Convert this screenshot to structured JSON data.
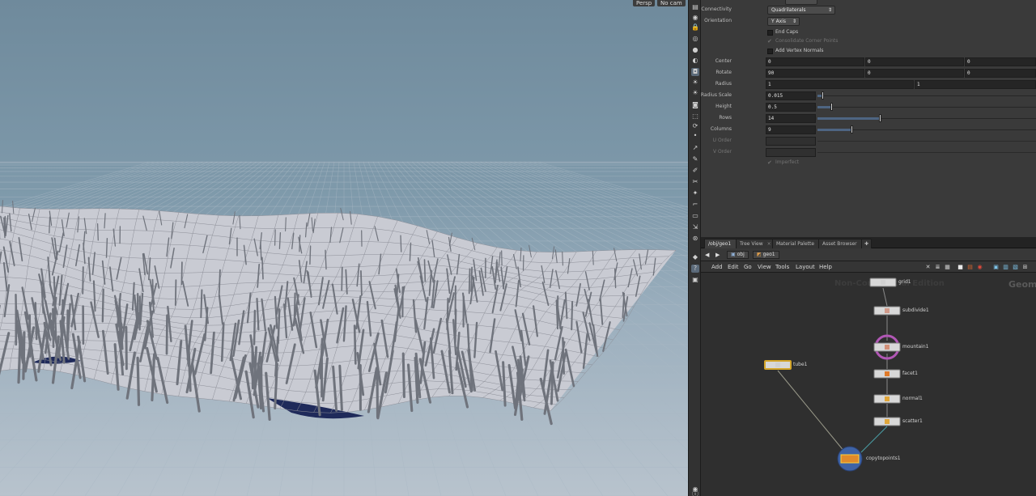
{
  "viewport": {
    "menu_persp": "Persp",
    "menu_camera": "No cam"
  },
  "toolstrip": {
    "icons": [
      "display-options-icon",
      "snap-icon",
      "lock-icon",
      "visibility-icon",
      "shading-icon",
      "ghost-icon",
      "select-mode-icon",
      "light-icon",
      "light2-icon",
      "handle-icon",
      "transform-icon",
      "cook-icon",
      "dot-icon",
      "wire-icon",
      "pen-icon",
      "edit-icon",
      "brush-icon",
      "paint-icon",
      "edge-icon",
      "poly-icon",
      "scale-icon",
      "pin-icon",
      "keyframe-icon",
      "help-icon",
      "render-icon",
      "camera-icon",
      "info-icon"
    ]
  },
  "params": {
    "connectivity": {
      "label": "Connectivity",
      "value": "Quadrilaterals"
    },
    "orientation": {
      "label": "Orientation",
      "value": "Y Axis"
    },
    "end_caps": {
      "label": "End Caps"
    },
    "consolidate": {
      "label": "Consolidate Corner Points"
    },
    "vertex_normals": {
      "label": "Add Vertex Normals"
    },
    "center": {
      "label": "Center",
      "x": "0",
      "y": "0",
      "z": "0"
    },
    "rotate": {
      "label": "Rotate",
      "x": "90",
      "y": "0",
      "z": "0"
    },
    "radius": {
      "label": "Radius",
      "x": "1",
      "y": "1"
    },
    "radius_scale": {
      "label": "Radius Scale",
      "value": "0.015",
      "level": 0.02
    },
    "height": {
      "label": "Height",
      "value": "0.5",
      "level": 0.06
    },
    "rows": {
      "label": "Rows",
      "value": "14",
      "level": 0.28
    },
    "columns": {
      "label": "Columns",
      "value": "9",
      "level": 0.15
    },
    "u_order": {
      "label": "U Order"
    },
    "v_order": {
      "label": "V Order"
    },
    "imperfect": {
      "label": "Imperfect"
    }
  },
  "network": {
    "tabs": [
      {
        "label": "/obj/geo1",
        "active": true
      },
      {
        "label": "Tree View",
        "active": false
      },
      {
        "label": "Material Palette",
        "active": false
      },
      {
        "label": "Asset Browser",
        "active": false
      }
    ],
    "path": {
      "root": "obj",
      "node": "geo1"
    },
    "menu": [
      "Add",
      "Edit",
      "Go",
      "View",
      "Tools",
      "Layout",
      "Help"
    ],
    "watermark_left": "Non-Commercial Edition",
    "watermark_right": "Geom",
    "nodes": [
      {
        "name": "grid1"
      },
      {
        "name": "subdivide1"
      },
      {
        "name": "mountain1"
      },
      {
        "name": "facet1"
      },
      {
        "name": "normal1"
      },
      {
        "name": "scatter1"
      },
      {
        "name": "tube1"
      },
      {
        "name": "copytopoints1"
      }
    ]
  },
  "colors": {
    "accent": "#4e6582",
    "selected_node": "#d4a52a",
    "copytopoints": "#3e63a6",
    "mountain_ring": "#b157b5"
  }
}
